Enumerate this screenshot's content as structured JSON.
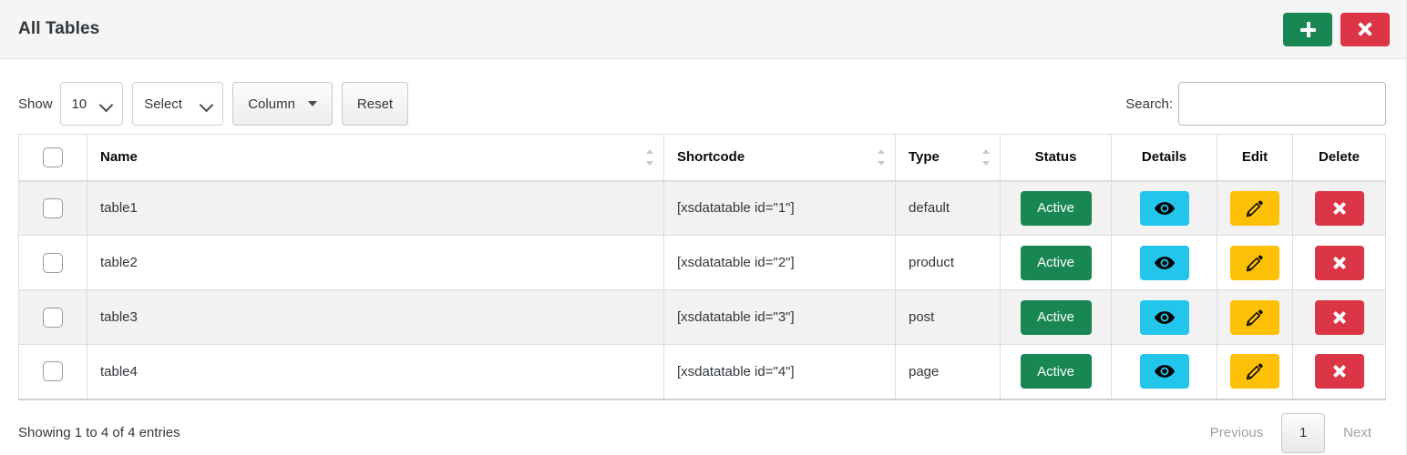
{
  "header": {
    "title": "All Tables",
    "add_button": {
      "name": "add-table-button",
      "icon": "plus-icon",
      "color": "#198754"
    },
    "close_button": {
      "name": "close-panel-button",
      "icon": "close-x-icon",
      "color": "#dc3545"
    }
  },
  "controls": {
    "show_label": "Show",
    "page_length_value": "10",
    "filter_select_value": "Select",
    "column_button_label": "Column",
    "reset_button_label": "Reset",
    "search_label": "Search:",
    "search_value": "",
    "search_placeholder": ""
  },
  "table": {
    "columns": [
      {
        "key": "check",
        "label": "",
        "sortable": false,
        "align": "center"
      },
      {
        "key": "name",
        "label": "Name",
        "sortable": true,
        "align": "left"
      },
      {
        "key": "short",
        "label": "Shortcode",
        "sortable": true,
        "align": "left"
      },
      {
        "key": "type",
        "label": "Type",
        "sortable": true,
        "align": "left"
      },
      {
        "key": "status",
        "label": "Status",
        "sortable": false,
        "align": "center"
      },
      {
        "key": "details",
        "label": "Details",
        "sortable": false,
        "align": "center"
      },
      {
        "key": "edit",
        "label": "Edit",
        "sortable": false,
        "align": "center"
      },
      {
        "key": "delete",
        "label": "Delete",
        "sortable": false,
        "align": "center"
      }
    ],
    "rows": [
      {
        "name": "table1",
        "shortcode": "[xsdatatable id=\"1\"]",
        "type": "default",
        "status": "Active"
      },
      {
        "name": "table2",
        "shortcode": "[xsdatatable id=\"2\"]",
        "type": "product",
        "status": "Active"
      },
      {
        "name": "table3",
        "shortcode": "[xsdatatable id=\"3\"]",
        "type": "post",
        "status": "Active"
      },
      {
        "name": "table4",
        "shortcode": "[xsdatatable id=\"4\"]",
        "type": "page",
        "status": "Active"
      }
    ],
    "action_icons": {
      "details": "eye-icon",
      "edit": "pencil-icon",
      "delete": "close-x-icon"
    },
    "colors": {
      "status_active": "#198754",
      "details_button": "#22c5ec",
      "edit_button": "#fcc006",
      "delete_button": "#dc3545",
      "row_stripe": "#f2f2f2"
    }
  },
  "footer": {
    "info": "Showing 1 to 4 of 4 entries",
    "previous_label": "Previous",
    "current_page": "1",
    "next_label": "Next"
  }
}
